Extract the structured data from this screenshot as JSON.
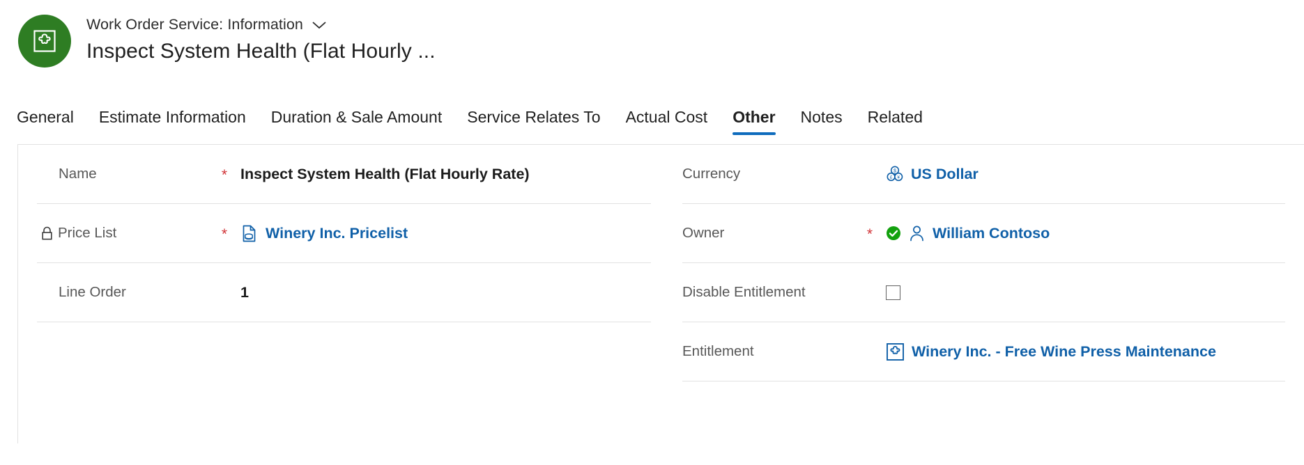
{
  "header": {
    "breadcrumb": "Work Order Service: Information",
    "record_title": "Inspect System Health (Flat Hourly ...",
    "avatar_icon": "work-order-service-icon",
    "chevron_icon": "chevron-down-icon",
    "avatar_color": "#2e7d23"
  },
  "tabs": [
    {
      "label": "General",
      "active": false
    },
    {
      "label": "Estimate Information",
      "active": false
    },
    {
      "label": "Duration & Sale Amount",
      "active": false
    },
    {
      "label": "Service Relates To",
      "active": false
    },
    {
      "label": "Actual Cost",
      "active": false
    },
    {
      "label": "Other",
      "active": true
    },
    {
      "label": "Notes",
      "active": false
    },
    {
      "label": "Related",
      "active": false
    }
  ],
  "tab_accent_color": "#0f6cbd",
  "required_star": "*",
  "form": {
    "left": [
      {
        "label": "Name",
        "label_icon": "",
        "required": true,
        "value": "Inspect System Health (Flat Hourly Rate)",
        "value_icon": "",
        "is_link": false,
        "bold": true
      },
      {
        "label": "Price List",
        "label_icon": "lock-icon",
        "required": true,
        "value": "Winery Inc. Pricelist",
        "value_icon": "price-list-icon",
        "is_link": true,
        "bold": true
      },
      {
        "label": "Line Order",
        "label_icon": "",
        "required": false,
        "value": "1",
        "value_icon": "",
        "is_link": false,
        "bold": true
      }
    ],
    "right": [
      {
        "label": "Currency",
        "label_icon": "",
        "required": false,
        "value": "US Dollar",
        "value_icon": "currency-coins-icon",
        "is_link": true,
        "bold": true
      },
      {
        "label": "Owner",
        "label_icon": "",
        "required": true,
        "value": "William Contoso",
        "value_icon": "person-icon",
        "status_icon": "verified-check-icon",
        "is_link": true,
        "bold": true
      },
      {
        "label": "Disable Entitlement",
        "label_icon": "",
        "required": false,
        "value": "",
        "value_icon": "checkbox-unchecked",
        "is_link": false,
        "bold": false,
        "checked": false
      },
      {
        "label": "Entitlement",
        "label_icon": "",
        "required": false,
        "value": "Winery Inc. - Free Wine Press Maintenance",
        "value_icon": "entitlement-icon",
        "is_link": true,
        "bold": true
      }
    ]
  },
  "colors": {
    "link": "#1060a8",
    "required": "#d13438",
    "accent": "#0f6cbd",
    "verified": "#13a10e",
    "rule": "#e1e1e1"
  }
}
